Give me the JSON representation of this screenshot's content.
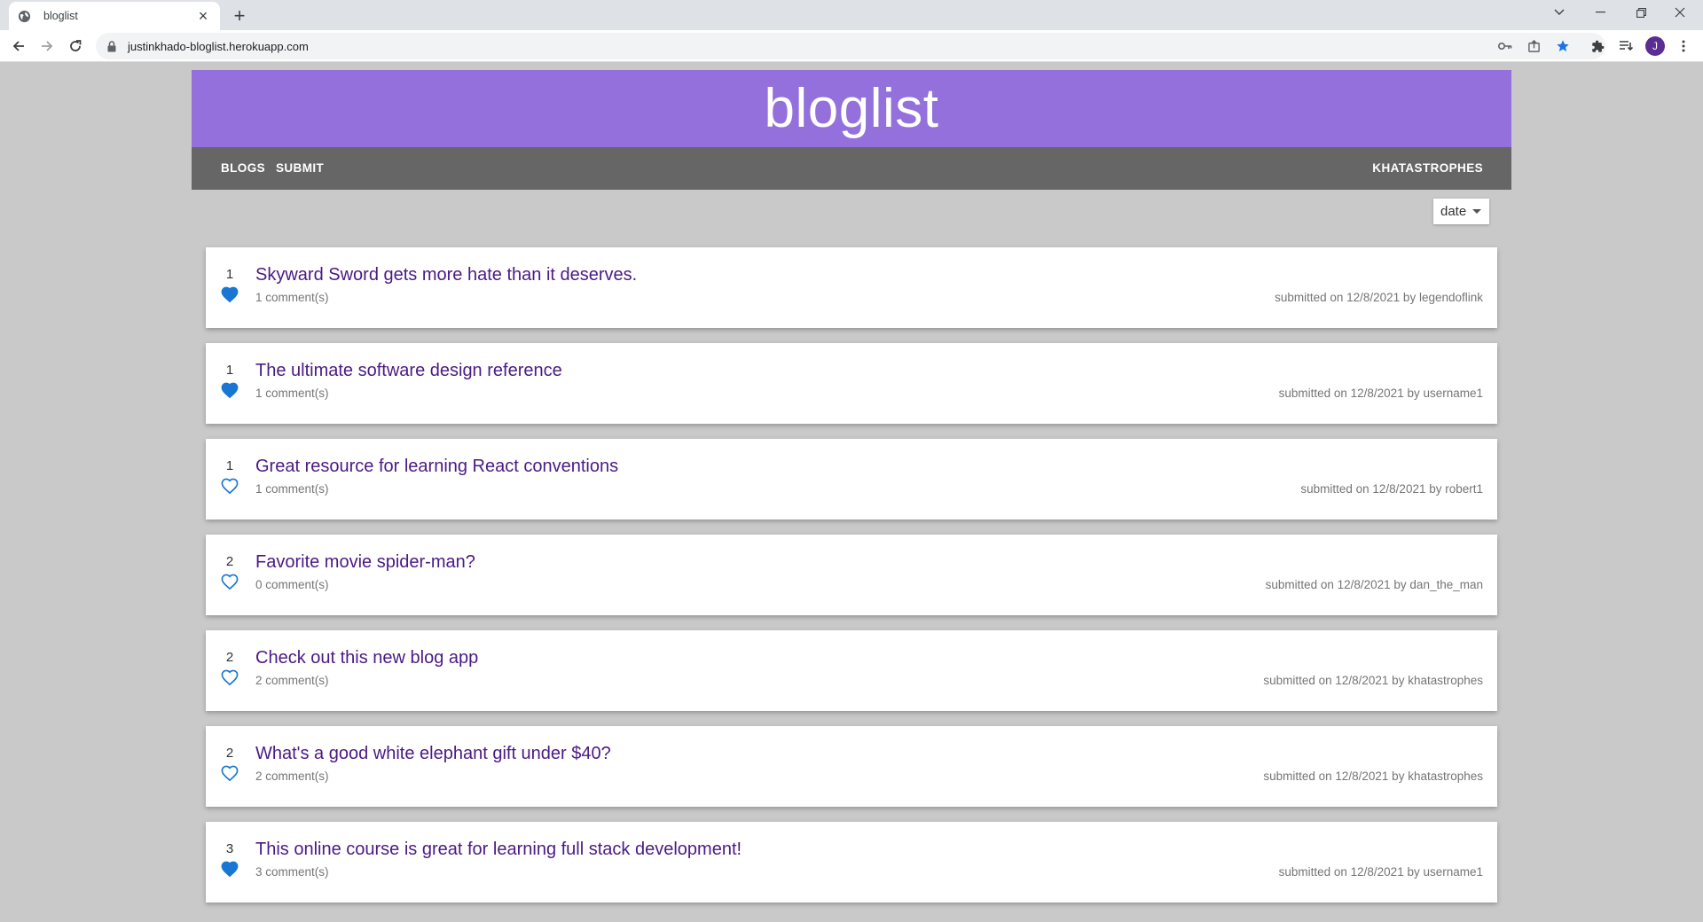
{
  "browser": {
    "tab_title": "bloglist",
    "url": "justinkhado-bloglist.herokuapp.com",
    "profile_initial": "J"
  },
  "app": {
    "brand": "bloglist",
    "nav": {
      "blogs": "BLOGS",
      "submit": "SUBMIT",
      "user": "KHATASTROPHES"
    },
    "sort": {
      "selected": "date"
    },
    "colors": {
      "header": "#9370db",
      "nav": "#666666",
      "title": "#4a1a84",
      "heart": "#1976d2"
    },
    "blogs": [
      {
        "likes": "1",
        "liked": true,
        "title": "Skyward Sword gets more hate than it deserves.",
        "comments": "1 comment(s)",
        "meta": "submitted on 12/8/2021 by legendoflink"
      },
      {
        "likes": "1",
        "liked": true,
        "title": "The ultimate software design reference",
        "comments": "1 comment(s)",
        "meta": "submitted on 12/8/2021 by username1"
      },
      {
        "likes": "1",
        "liked": false,
        "title": "Great resource for learning React conventions",
        "comments": "1 comment(s)",
        "meta": "submitted on 12/8/2021 by robert1"
      },
      {
        "likes": "2",
        "liked": false,
        "title": "Favorite movie spider-man?",
        "comments": "0 comment(s)",
        "meta": "submitted on 12/8/2021 by dan_the_man"
      },
      {
        "likes": "2",
        "liked": false,
        "title": "Check out this new blog app",
        "comments": "2 comment(s)",
        "meta": "submitted on 12/8/2021 by khatastrophes"
      },
      {
        "likes": "2",
        "liked": false,
        "title": "What's a good white elephant gift under $40?",
        "comments": "2 comment(s)",
        "meta": "submitted on 12/8/2021 by khatastrophes"
      },
      {
        "likes": "3",
        "liked": true,
        "title": "This online course is great for learning full stack development!",
        "comments": "3 comment(s)",
        "meta": "submitted on 12/8/2021 by username1"
      }
    ]
  }
}
